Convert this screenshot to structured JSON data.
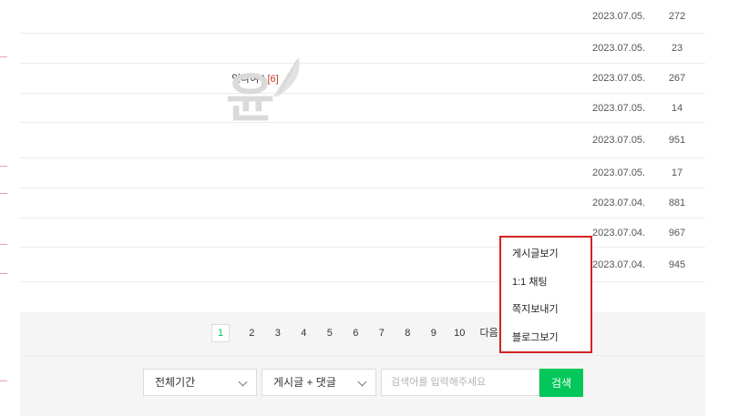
{
  "rows": [
    {
      "title": "",
      "count": "",
      "date": "2023.07.05.",
      "views": "272"
    },
    {
      "title": "",
      "count": "",
      "date": "2023.07.05.",
      "views": "23"
    },
    {
      "title": "있나여?",
      "count": "[6]",
      "date": "2023.07.05.",
      "views": "267"
    },
    {
      "title": "",
      "count": "",
      "date": "2023.07.05.",
      "views": "14"
    },
    {
      "title": "",
      "count": "",
      "date": "2023.07.05.",
      "views": "951"
    },
    {
      "title": "",
      "count": "",
      "date": "2023.07.05.",
      "views": "17"
    },
    {
      "title": "",
      "count": "",
      "date": "2023.07.04.",
      "views": "881"
    },
    {
      "title": "",
      "count": "",
      "date": "2023.07.04.",
      "views": "967"
    },
    {
      "title": "",
      "count": "",
      "date": "2023.07.04.",
      "views": "945"
    }
  ],
  "watermark": {
    "text": "윤"
  },
  "pagination": {
    "current": "1",
    "pages": [
      "2",
      "3",
      "4",
      "5",
      "6",
      "7",
      "8",
      "9",
      "10"
    ],
    "next_label": "다음"
  },
  "context_menu": {
    "items": [
      "게시글보기",
      "1:1 채팅",
      "쪽지보내기",
      "블로그보기"
    ]
  },
  "search": {
    "period_selected": "전체기간",
    "scope_selected": "게시글 + 댓글",
    "placeholder": "검색어를 입력해주세요",
    "button_label": "검색"
  },
  "colors": {
    "accent_green": "#03c75a",
    "highlight_red": "#d32222",
    "comment_count": "#c0392b"
  }
}
